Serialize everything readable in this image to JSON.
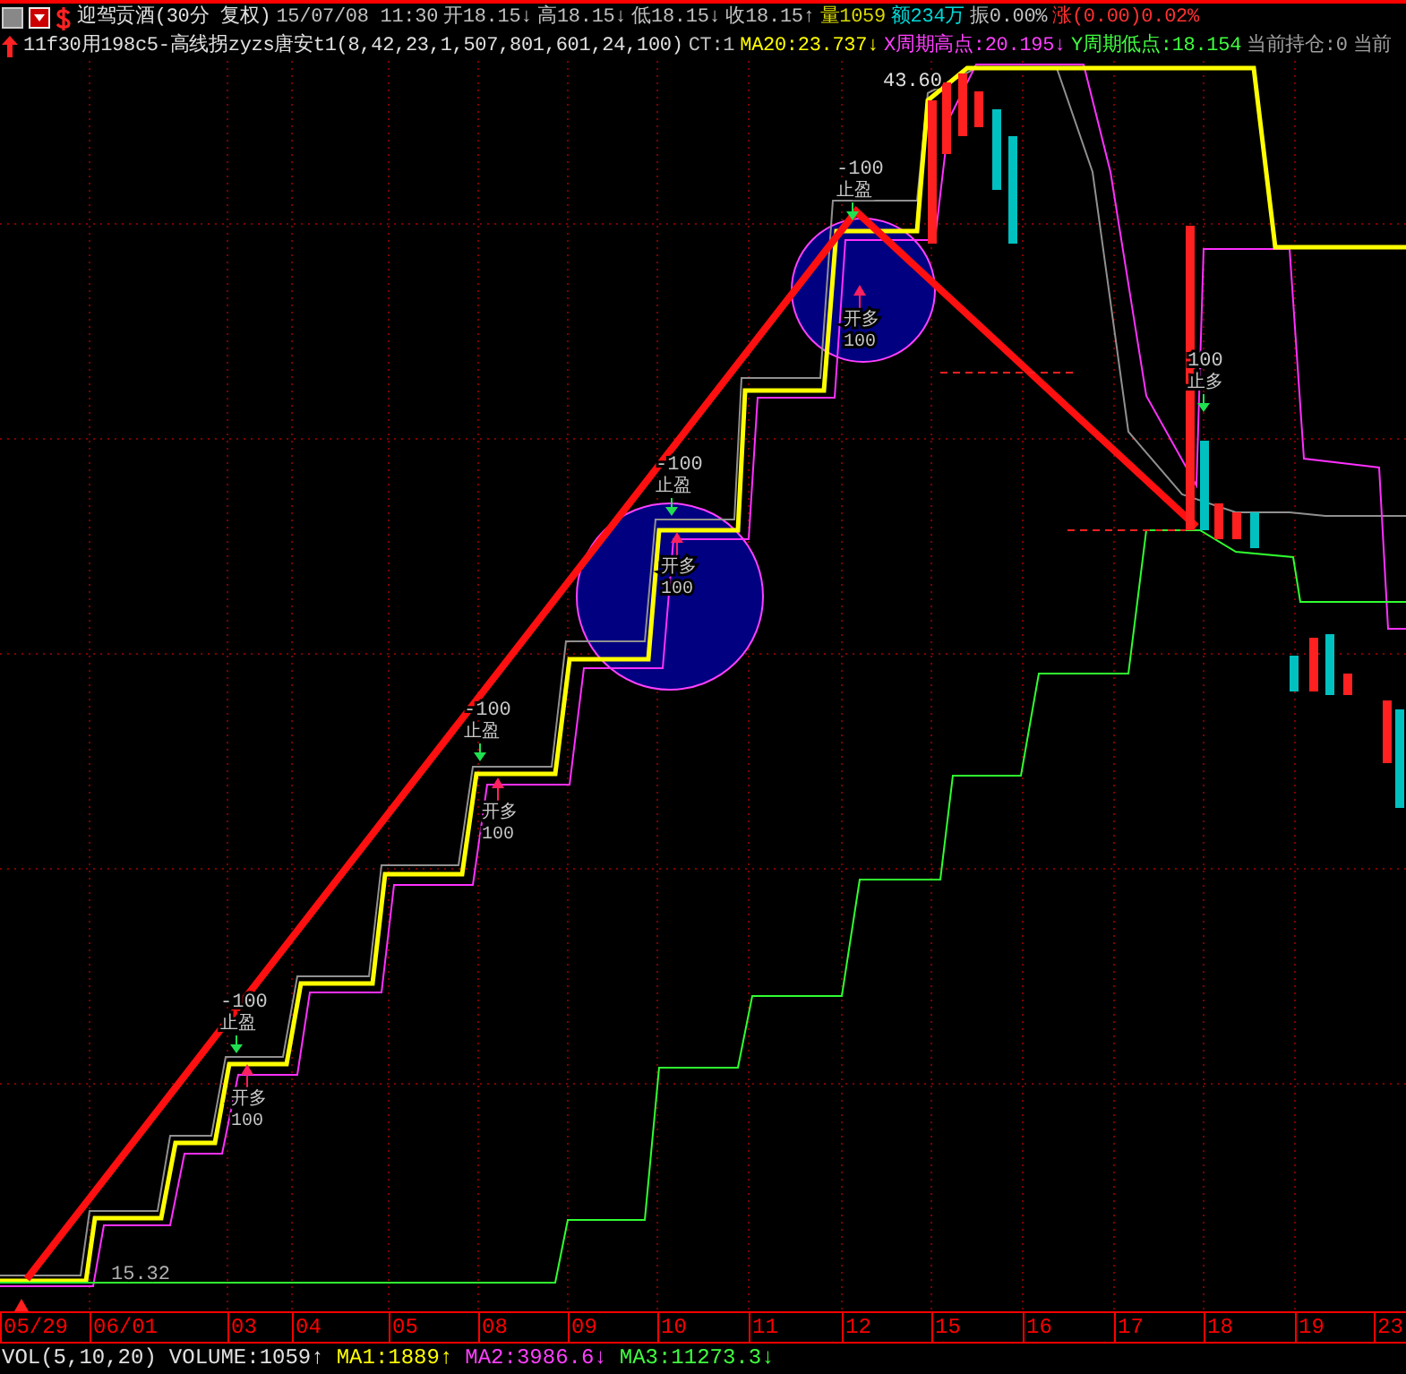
{
  "header": {
    "title": "迎驾贡酒(30分 复权)",
    "datetime": "15/07/08 11:30",
    "quotes": [
      {
        "text": "开18.15↓",
        "color": "#c0c0c0"
      },
      {
        "text": "高18.15↓",
        "color": "#c0c0c0"
      },
      {
        "text": "低18.15↓",
        "color": "#c0c0c0"
      },
      {
        "text": "收18.15↑",
        "color": "#c0c0c0"
      },
      {
        "text": "量1059",
        "color": "#d8d800"
      },
      {
        "text": "额234万",
        "color": "#00d8d8"
      },
      {
        "text": "振0.00%",
        "color": "#c0c0c0"
      },
      {
        "text": "涨(0.00)0.02%",
        "color": "#ff3030"
      }
    ]
  },
  "indicator": {
    "formula": "11f30用198c5-高线拐zyzs唐安t1(8,42,23,1,507,801,601,24,100)",
    "values": [
      {
        "text": "CT:1",
        "color": "#c0c0c0"
      },
      {
        "text": "MA20:23.737↓",
        "color": "#ffff00"
      },
      {
        "text": "X周期高点:20.195↓",
        "color": "#ff40ff"
      },
      {
        "text": "Y周期低点:18.154",
        "color": "#40ff40"
      },
      {
        "text": "当前持仓:0",
        "color": "#a0a0a0"
      },
      {
        "text": "当前",
        "color": "#a0a0a0"
      }
    ]
  },
  "chart": {
    "price_high": "43.60",
    "price_low": "15.32",
    "signals": [
      {
        "kind": "stop",
        "qty": "-100",
        "label": "止盈"
      },
      {
        "kind": "stop",
        "qty": "-100",
        "label": "止盈"
      },
      {
        "kind": "stop",
        "qty": "-100",
        "label": "止盈"
      },
      {
        "kind": "stop",
        "qty": "-100",
        "label": "止盈"
      },
      {
        "kind": "stop",
        "qty": "100",
        "label": "止多"
      },
      {
        "kind": "open",
        "qty": "100",
        "label": "开多"
      },
      {
        "kind": "open",
        "qty": "100",
        "label": "开多"
      },
      {
        "kind": "open",
        "qty": "100",
        "label": "开多"
      },
      {
        "kind": "open",
        "qty": "100",
        "label": "开多"
      }
    ]
  },
  "date_axis": [
    "05/29",
    "06/01",
    "03",
    "04",
    "05",
    "08",
    "09",
    "10",
    "11",
    "12",
    "15",
    "16",
    "17",
    "18",
    "19",
    "23"
  ],
  "volume": {
    "name": "VOL(5,10,20)",
    "values": [
      {
        "text": "VOLUME:1059↑",
        "color": "#e0e0e0"
      },
      {
        "text": "MA1:1889↑",
        "color": "#ffff00"
      },
      {
        "text": "MA2:3986.6↓",
        "color": "#ff40ff"
      },
      {
        "text": "MA3:11273.3↓",
        "color": "#40ff40"
      }
    ]
  }
}
